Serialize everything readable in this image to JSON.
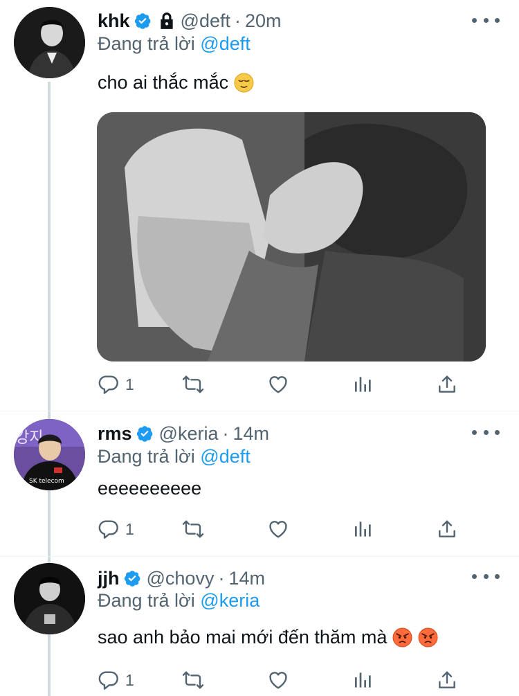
{
  "colors": {
    "accent": "#1d9bf0",
    "muted": "#536471",
    "text": "#0f1419",
    "line": "#cfd9de"
  },
  "tweets": [
    {
      "name": "khk",
      "handle": "@deft",
      "separator": "·",
      "time": "20m",
      "verified": true,
      "protected": true,
      "reply_prefix": "Đang trả lời",
      "reply_to": "@deft",
      "text": "cho ai thắc mắc",
      "emoji": [
        "relieved-face"
      ],
      "has_media": true,
      "reply_count": "1"
    },
    {
      "name": "rms",
      "handle": "@keria",
      "separator": "·",
      "time": "14m",
      "verified": true,
      "protected": false,
      "reply_prefix": "Đang trả lời",
      "reply_to": "@deft",
      "text": "eeeeeeeeee",
      "emoji": [],
      "has_media": false,
      "reply_count": "1"
    },
    {
      "name": "jjh",
      "handle": "@chovy",
      "separator": "·",
      "time": "14m",
      "verified": true,
      "protected": false,
      "reply_prefix": "Đang trả lời",
      "reply_to": "@keria",
      "text": "sao anh bảo mai mới đến thăm mà",
      "emoji": [
        "angry-face",
        "angry-face"
      ],
      "has_media": false,
      "reply_count": "1"
    }
  ],
  "icons": {
    "reply": "reply-icon",
    "retweet": "retweet-icon",
    "like": "like-icon",
    "views": "analytics-icon",
    "share": "share-icon",
    "more": "more-icon",
    "verified": "verified-badge-icon",
    "lock": "lock-icon"
  }
}
